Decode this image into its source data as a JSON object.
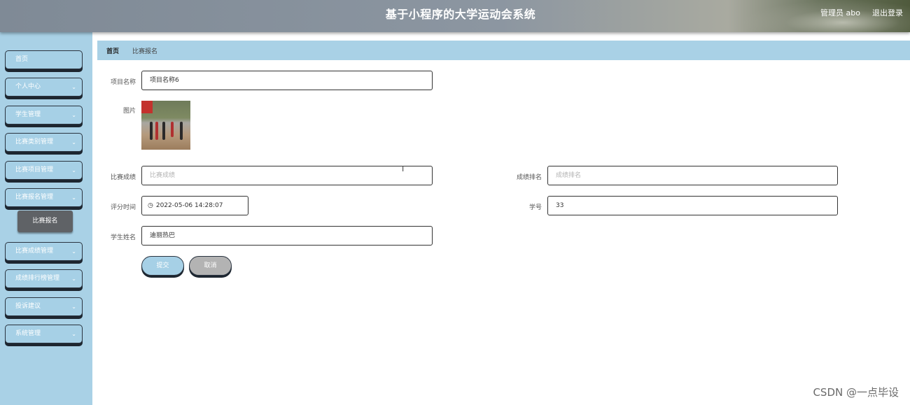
{
  "header": {
    "title": "基于小程序的大学运动会系统",
    "user": "管理员 abo",
    "logout": "退出登录"
  },
  "sidebar": {
    "items": [
      {
        "label": "首页",
        "has_arrow": false
      },
      {
        "label": "个人中心",
        "has_arrow": true
      },
      {
        "label": "学生管理",
        "has_arrow": true
      },
      {
        "label": "比赛类别管理",
        "has_arrow": true
      },
      {
        "label": "比赛项目管理",
        "has_arrow": true
      },
      {
        "label": "比赛报名管理",
        "has_arrow": true
      },
      {
        "label": "比赛成绩管理",
        "has_arrow": true
      },
      {
        "label": "成绩排行榜管理",
        "has_arrow": true
      },
      {
        "label": "投诉建议",
        "has_arrow": true
      },
      {
        "label": "系统管理",
        "has_arrow": true
      }
    ],
    "sub_item": "比赛报名",
    "chevron": "⌄"
  },
  "breadcrumb": {
    "home": "首页",
    "current": "比赛报名"
  },
  "form": {
    "project_name_label": "项目名称",
    "project_name_value": "项目名称6",
    "image_label": "图片",
    "score_label": "比赛成绩",
    "score_placeholder": "比赛成绩",
    "rank_label": "成绩排名",
    "rank_placeholder": "成绩排名",
    "time_label": "评分时间",
    "time_value": "2022-05-06 14:28:07",
    "student_id_label": "学号",
    "student_id_value": "33",
    "student_name_label": "学生姓名",
    "student_name_value": "迪丽热巴",
    "submit": "提交",
    "cancel": "取消"
  },
  "watermark": "CSDN @一点毕设",
  "colors": {
    "accent": "#a9d1e6",
    "submenu": "#5f6266",
    "cancel": "#b3b3b3"
  }
}
